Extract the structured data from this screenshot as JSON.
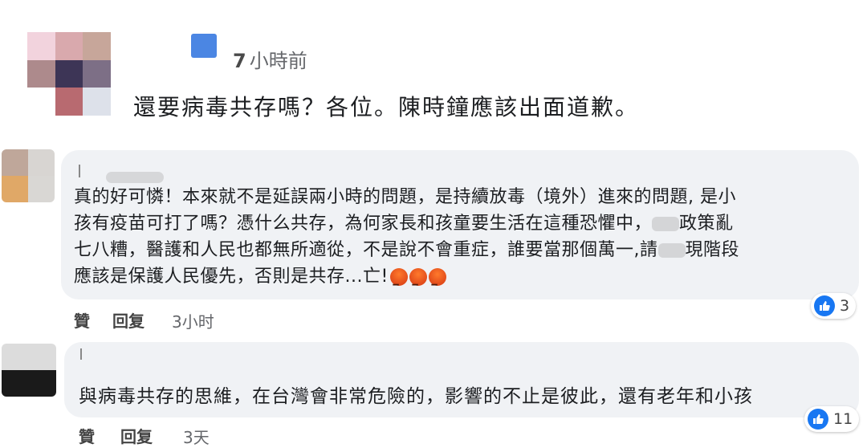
{
  "post": {
    "time_number": "7",
    "time_unit": "小時前",
    "text": "還要病毒共存嗎？各位。陳時鐘應該出面道歉。"
  },
  "comments": [
    {
      "line1": "真的好可憐！本來就不是延誤兩小時的問題，是持續放毒（境外）進來的問題, 是小",
      "line2a": "孩有疫苗可打了嗎？憑什么共存，為何家長和孩童要生活在這種恐懼中，",
      "line2b": "政策亂",
      "line3a": "七八糟，醫護和人民也都無所適從，不是說不會重症，誰要當那個萬一,請",
      "line3b": "現階段",
      "line4": "應該是保護人民優先，否則是共存...亡!",
      "like_label": "贊",
      "reply_label": "回复",
      "time": "3小时",
      "reaction_count": "3"
    },
    {
      "text": "與病毒共存的思維，在台灣會非常危險的，影響的不止是彼此，還有老年和小孩",
      "like_label": "贊",
      "reply_label": "回复",
      "time": "3天",
      "reaction_count": "11"
    }
  ],
  "colors": {
    "bubble": "#f0f2f5",
    "like_blue": "#1877f2",
    "name_blot": "#4b86e3",
    "meta_gray": "#65676b"
  },
  "icons": [
    "thumbs-up-icon",
    "angry-face-icon"
  ]
}
